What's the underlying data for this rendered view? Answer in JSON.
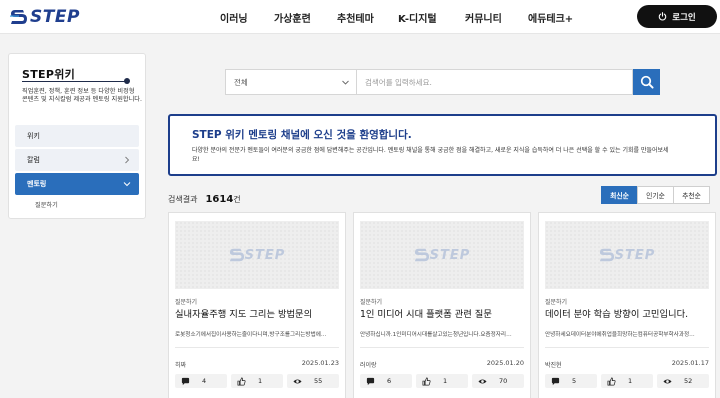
{
  "header": {
    "logo": "STEP",
    "nav": [
      "이러닝",
      "가상훈련",
      "추천테마",
      "K-디지털",
      "커뮤니티",
      "에듀테크+"
    ],
    "login_label": "로그인"
  },
  "sidebar": {
    "title": "STEP위키",
    "desc": "직업훈련, 정책, 훈련 정보 등 다양한 비정형 콘텐츠 및 지식칼럼 제공과 멘토링 지원합니다.",
    "items": [
      {
        "label": "위키"
      },
      {
        "label": "칼럼"
      },
      {
        "label": "멘토링"
      }
    ],
    "sub_item": "질문하기"
  },
  "search": {
    "select_value": "전체",
    "placeholder": "검색어를 입력하세요."
  },
  "welcome": {
    "title": "STEP 위키 멘토링 채널에 오신 것을 환영합니다.",
    "desc": "다양한 분야의 전문가 멘토들이 여러분의 궁금한 점에 답변해주는 공간입니다. 멘토링 채널을 통해 궁금한 점을 해결하고, 새로운 지식을 습득하여 더 나은 선택을 할 수 있는 기회를 만들어보세요!"
  },
  "results": {
    "label": "검색결과",
    "count": "1614",
    "unit": "건"
  },
  "sort": [
    "최신순",
    "인기순",
    "추천순"
  ],
  "cards": [
    {
      "thumb_logo": "STEP",
      "category": "질문하기",
      "title": "실내자율주행 지도 그리는 방법문의",
      "excerpt": "로봇청소기에서집이사용하는줄이다니며,방구조를그리는방법에…",
      "author": "히짜",
      "date": "2025.01.23",
      "comments": "4",
      "likes": "1",
      "views": "55"
    },
    {
      "thumb_logo": "STEP",
      "category": "질문하기",
      "title": "1인 미디어 시대 플랫폼 관련 질문",
      "excerpt": "안녕하십니까.1인미디어시대를살고있는청년입니다.요즘정자리…",
      "author": "러이랑",
      "date": "2025.01.20",
      "comments": "6",
      "likes": "1",
      "views": "70"
    },
    {
      "thumb_logo": "STEP",
      "category": "질문하기",
      "title": "데이터 분야 학습 방향이 고민입니다.",
      "excerpt": "안녕하세요데이터분야에취업을희망하는컴퓨터공학부학사과정…",
      "author": "박진현",
      "date": "2025.01.17",
      "comments": "5",
      "likes": "1",
      "views": "52"
    }
  ]
}
